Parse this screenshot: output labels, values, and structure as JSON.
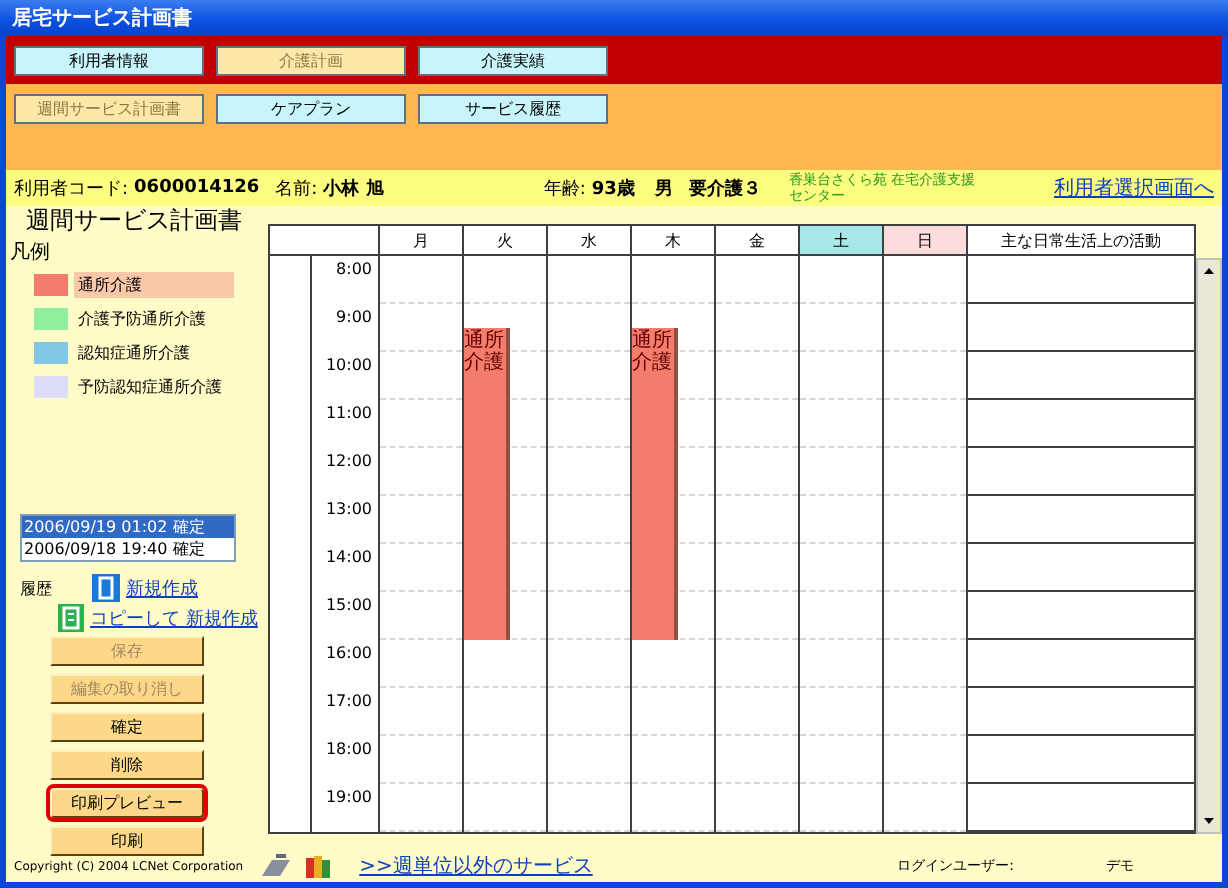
{
  "window": {
    "title": "居宅サービス計画書"
  },
  "main_tabs": [
    {
      "label": "利用者情報",
      "selected": false
    },
    {
      "label": "介護計画",
      "selected": true
    },
    {
      "label": "介護実績",
      "selected": false
    }
  ],
  "sub_tabs": [
    {
      "label": "週間サービス計画書",
      "selected": true
    },
    {
      "label": "ケアプラン",
      "selected": false
    },
    {
      "label": "サービス履歴",
      "selected": false
    }
  ],
  "user_info": {
    "code_label": "利用者コード:",
    "code": "0600014126",
    "name_label": "名前:",
    "name": "小林 旭",
    "age_label": "年齢:",
    "age": "93歳",
    "sex": "男",
    "care_level": "要介護３",
    "office": "香巣台さくら苑 在宅介護支援センター",
    "select_user_link": "利用者選択画面へ"
  },
  "page_title": "週間サービス計画書",
  "legend": {
    "title": "凡例",
    "items": [
      {
        "label": "通所介護",
        "color": "#f47c6c",
        "selected": true
      },
      {
        "label": "介護予防通所介護",
        "color": "#90f0a0",
        "selected": false
      },
      {
        "label": "認知症通所介護",
        "color": "#80c8e8",
        "selected": false
      },
      {
        "label": "予防認知症通所介護",
        "color": "#dcdcf8",
        "selected": false
      }
    ]
  },
  "history": {
    "items": [
      {
        "text": "2006/09/19 01:02 確定",
        "selected": true
      },
      {
        "text": "2006/09/18 19:40 確定",
        "selected": false
      }
    ],
    "label": "履歴",
    "new_link": "新規作成",
    "copy_link": "コピーして 新規作成"
  },
  "buttons": [
    {
      "label": "保存",
      "disabled": true,
      "selected": false
    },
    {
      "label": "編集の取り消し",
      "disabled": true,
      "selected": false
    },
    {
      "label": "確定",
      "disabled": false,
      "selected": false
    },
    {
      "label": "削除",
      "disabled": false,
      "selected": false
    },
    {
      "label": "印刷プレビュー",
      "disabled": false,
      "selected": true
    },
    {
      "label": "印刷",
      "disabled": false,
      "selected": false
    }
  ],
  "schedule": {
    "times": [
      "8:00",
      "9:00",
      "10:00",
      "11:00",
      "12:00",
      "13:00",
      "14:00",
      "15:00",
      "16:00",
      "17:00",
      "18:00",
      "19:00"
    ],
    "days": [
      {
        "label": "月",
        "kind": "weekday"
      },
      {
        "label": "火",
        "kind": "weekday",
        "service": {
          "label": "通所介護",
          "color": "#f47c6c",
          "half_hours": [
            {
              "booked": false
            },
            {
              "booked": false
            },
            {
              "booked": false
            },
            {
              "booked": true
            },
            {
              "booked": true
            },
            {
              "booked": true
            },
            {
              "booked": true
            },
            {
              "booked": true
            },
            {
              "booked": true
            },
            {
              "booked": true
            },
            {
              "booked": true
            },
            {
              "booked": true
            },
            {
              "booked": true
            },
            {
              "booked": true
            },
            {
              "booked": true
            },
            {
              "booked": true
            },
            {
              "booked": false
            },
            {
              "booked": false
            },
            {
              "booked": false
            },
            {
              "booked": false
            },
            {
              "booked": false
            },
            {
              "booked": false
            },
            {
              "booked": false
            },
            {
              "booked": false
            }
          ]
        }
      },
      {
        "label": "水",
        "kind": "weekday"
      },
      {
        "label": "木",
        "kind": "weekday",
        "service": {
          "label": "通所介護",
          "color": "#f47c6c",
          "half_hours": [
            {
              "booked": false
            },
            {
              "booked": false
            },
            {
              "booked": false
            },
            {
              "booked": true
            },
            {
              "booked": true
            },
            {
              "booked": true
            },
            {
              "booked": true
            },
            {
              "booked": true
            },
            {
              "booked": true
            },
            {
              "booked": true
            },
            {
              "booked": true
            },
            {
              "booked": true
            },
            {
              "booked": true
            },
            {
              "booked": true
            },
            {
              "booked": true
            },
            {
              "booked": true
            },
            {
              "booked": false
            },
            {
              "booked": false
            },
            {
              "booked": false
            },
            {
              "booked": false
            },
            {
              "booked": false
            },
            {
              "booked": false
            },
            {
              "booked": false
            },
            {
              "booked": false
            }
          ]
        }
      },
      {
        "label": "金",
        "kind": "weekday"
      },
      {
        "label": "土",
        "kind": "saturday"
      },
      {
        "label": "日",
        "kind": "sunday"
      }
    ],
    "activity_header": "主な日常生活上の活動"
  },
  "footer": {
    "copyright": "Copyright (C) 2004 LCNet Corporation",
    "other_services_link": ">>週単位以外のサービス",
    "login_label": "ログインユーザー:",
    "login_user": "デモ"
  }
}
